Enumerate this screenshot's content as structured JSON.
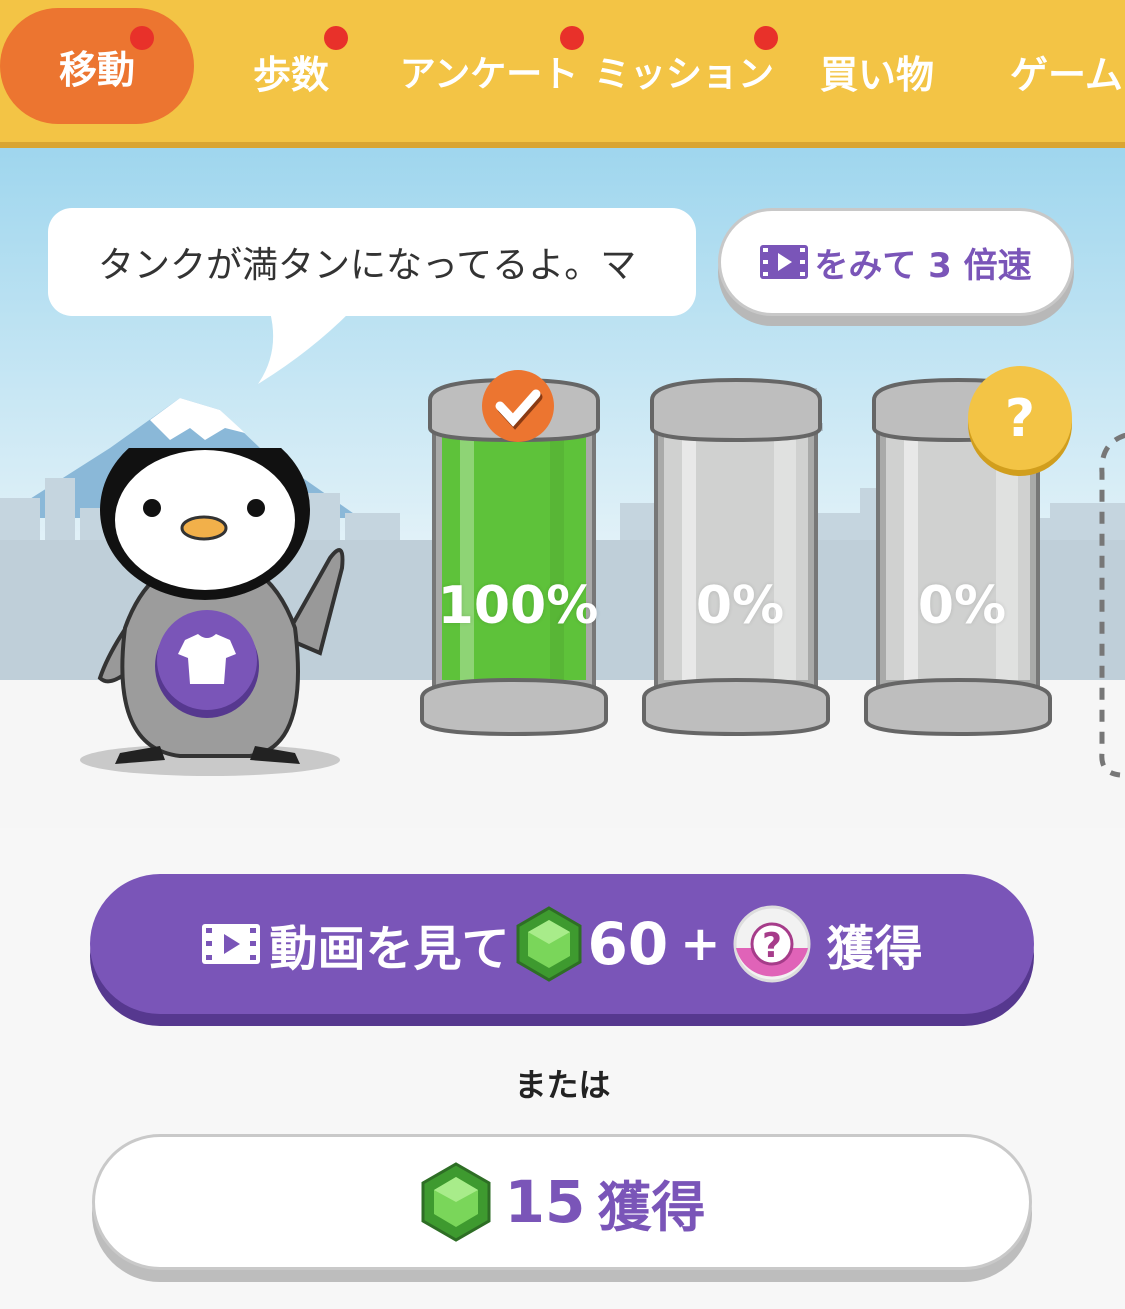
{
  "tabs": [
    {
      "label": "移動",
      "active": true,
      "badge": true
    },
    {
      "label": "歩数",
      "active": false,
      "badge": true
    },
    {
      "label": "アンケート",
      "active": false,
      "badge": true
    },
    {
      "label": "ミッション",
      "active": false,
      "badge": true
    },
    {
      "label": "買い物",
      "active": false,
      "badge": false
    },
    {
      "label": "ゲーム",
      "active": false,
      "badge": false
    }
  ],
  "speech_bubble": {
    "text": "タンクが満タンになってるよ。マ"
  },
  "speed_button": {
    "icon": "video-icon",
    "label": "をみて 3 倍速"
  },
  "tanks": [
    {
      "label": "100%",
      "fill": 1.0,
      "status": "check-icon"
    },
    {
      "label": "0%",
      "fill": 0.0,
      "status": ""
    },
    {
      "label": "0%",
      "fill": 0.0,
      "status": "question-icon"
    }
  ],
  "video_reward_button": {
    "icon": "video-icon",
    "label_prefix": "動画を見て",
    "gem_amount": "60",
    "plus": "+",
    "label_suffix": "獲得"
  },
  "or_text": "または",
  "gem_reward_button": {
    "gem_amount": "15",
    "label": "獲得"
  },
  "colors": {
    "accent_orange": "#ec7530",
    "header_yellow": "#f3c445",
    "purple": "#7a55b8",
    "tank_green": "#5ec23a"
  }
}
